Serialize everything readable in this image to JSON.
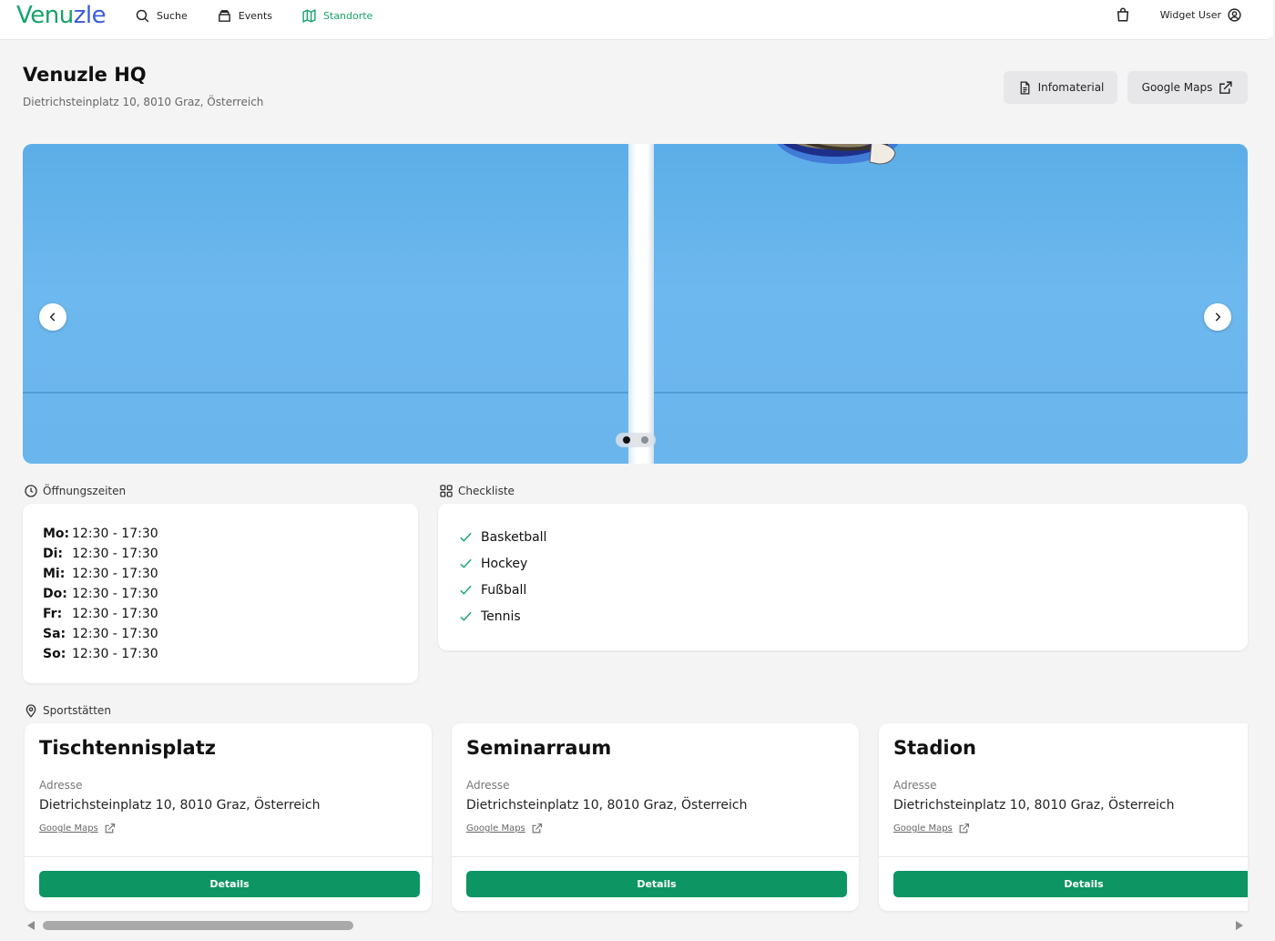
{
  "header": {
    "logo": "Venuzle",
    "nav": [
      {
        "label": "Suche",
        "icon": "search-icon"
      },
      {
        "label": "Events",
        "icon": "calendar-box-icon"
      },
      {
        "label": "Standorte",
        "icon": "map-icon",
        "active": true
      }
    ],
    "user_label": "Widget User",
    "cart_icon": "shopping-bag-icon",
    "user_icon": "user-circle-icon"
  },
  "venue": {
    "title": "Venuzle HQ",
    "address": "Dietrichsteinplatz 10, 8010 Graz, Österreich",
    "info_button": "Infomaterial",
    "maps_button": "Google Maps"
  },
  "carousel": {
    "slide_count": 2,
    "active_slide": 1
  },
  "opening_hours": {
    "label": "Öffnungszeiten",
    "rows": [
      {
        "day": "Mo:",
        "time": "12:30 - 17:30"
      },
      {
        "day": "Di:",
        "time": "12:30 - 17:30"
      },
      {
        "day": "Mi:",
        "time": "12:30 - 17:30"
      },
      {
        "day": "Do:",
        "time": "12:30 - 17:30"
      },
      {
        "day": "Fr:",
        "time": "12:30 - 17:30"
      },
      {
        "day": "Sa:",
        "time": "12:30 - 17:30"
      },
      {
        "day": "So:",
        "time": "12:30 - 17:30"
      }
    ]
  },
  "checklist": {
    "label": "Checkliste",
    "items": [
      "Basketball",
      "Hockey",
      "Fußball",
      "Tennis"
    ]
  },
  "facilities": {
    "label": "Sportstätten",
    "items": [
      {
        "title": "Tischtennisplatz",
        "address_label": "Adresse",
        "address": "Dietrichsteinplatz 10, 8010 Graz, Österreich",
        "maps": "Google Maps",
        "button": "Details"
      },
      {
        "title": "Seminarraum",
        "address_label": "Adresse",
        "address": "Dietrichsteinplatz 10, 8010 Graz, Österreich",
        "maps": "Google Maps",
        "button": "Details"
      },
      {
        "title": "Stadion",
        "address_label": "Adresse",
        "address": "Dietrichsteinplatz 10, 8010 Graz, Österreich",
        "maps": "Google Maps",
        "button": "Details"
      }
    ]
  },
  "colors": {
    "brand_green": "#0d9563",
    "logo_green": "#16a36a",
    "logo_blue": "#3b5bdb"
  }
}
